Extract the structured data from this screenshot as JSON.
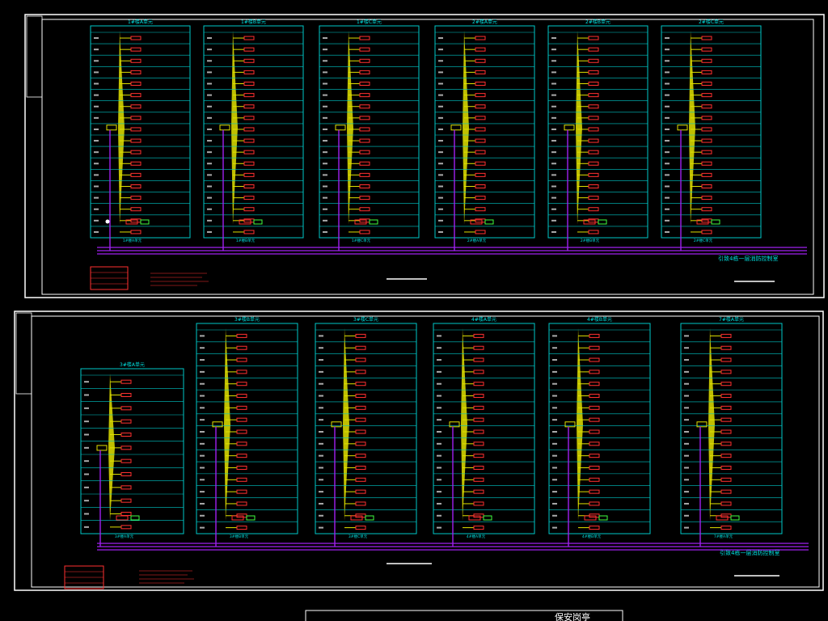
{
  "drawing": {
    "sheets": [
      {
        "id": "top",
        "columns": [
          {
            "title": "1#楼A单元",
            "footer": "1#楼A单元"
          },
          {
            "title": "1#楼B单元",
            "footer": "1#楼B单元"
          },
          {
            "title": "1#楼C单元",
            "footer": "1#楼C单元"
          },
          {
            "title": "2#楼A单元",
            "footer": "2#楼A单元"
          },
          {
            "title": "2#楼B单元",
            "footer": "2#楼B单元"
          },
          {
            "title": "2#楼C单元",
            "footer": "2#楼C单元"
          }
        ],
        "bus_note": "引致4栋一层消防控制室"
      },
      {
        "id": "bottom",
        "columns": [
          {
            "title": "3#楼A单元",
            "footer": "3#楼A单元"
          },
          {
            "title": "3#楼B单元",
            "footer": "3#楼B单元"
          },
          {
            "title": "3#楼C单元",
            "footer": "3#楼C单元"
          },
          {
            "title": "4#楼A单元",
            "footer": "4#楼A单元"
          },
          {
            "title": "4#楼B单元",
            "footer": "4#楼B单元"
          },
          {
            "title": "7#楼A单元",
            "footer": "7#楼A单元"
          }
        ],
        "bus_note": "引致4栋一层消防控制室"
      }
    ],
    "bottom_title": "保安岗亭",
    "colors": {
      "frame": "#ffffff",
      "column_border": "#00c8c8",
      "bus": "#a020f0",
      "riser": "#e0e000",
      "device": "#ff3030",
      "label": "#00e0e0"
    }
  }
}
